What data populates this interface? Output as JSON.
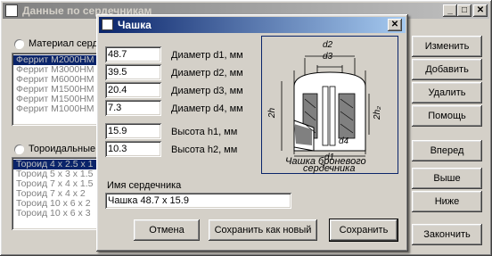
{
  "main_window": {
    "title": "Данные по сердечникам",
    "radio_material": "Материал серд",
    "materials": [
      "Феррит М2000НМ",
      "Феррит М3000НМ",
      "Феррит М6000НМ",
      "Феррит М1500НМ",
      "Феррит М1500НМ",
      "Феррит М1000НМ"
    ],
    "radio_toroid": "Тороидальные",
    "toroids": [
      "Тороид 4 x 2.5 x 1",
      "Тороид 5 x 3 x 1.5",
      "Тороид 7 x 4 x 1.5",
      "Тороид 7 x 4 x 2",
      "Тороид 10 x 6 x 2",
      "Тороид 10 x 6 x 3"
    ],
    "buttons": {
      "change": "Изменить",
      "add": "Добавить",
      "delete": "Удалить",
      "help": "Помощь",
      "forward": "Вперед",
      "up": "Выше",
      "down": "Ниже",
      "finish": "Закончить"
    }
  },
  "dialog": {
    "title": "Чашка",
    "fields": [
      {
        "value": "48.7",
        "label": "Диаметр d1, мм"
      },
      {
        "value": "39.5",
        "label": "Диаметр d2, мм"
      },
      {
        "value": "20.4",
        "label": "Диаметр d3, мм"
      },
      {
        "value": "7.3",
        "label": "Диаметр d4, мм"
      },
      {
        "value": "15.9",
        "label": "Высота h1, мм"
      },
      {
        "value": "10.3",
        "label": "Высота h2, мм"
      }
    ],
    "name_label": "Имя сердечника",
    "name_value": "Чашка 48.7 x 15.9",
    "diagram": {
      "d1": "d1",
      "d2": "d2",
      "d3": "d3",
      "d4": "d4",
      "h1": "2h",
      "h2": "2h₂",
      "caption1": "Чашка броневого",
      "caption2": "сердечника"
    },
    "buttons": {
      "cancel": "Отмена",
      "save_new": "Сохранить как новый",
      "save": "Сохранить"
    }
  }
}
